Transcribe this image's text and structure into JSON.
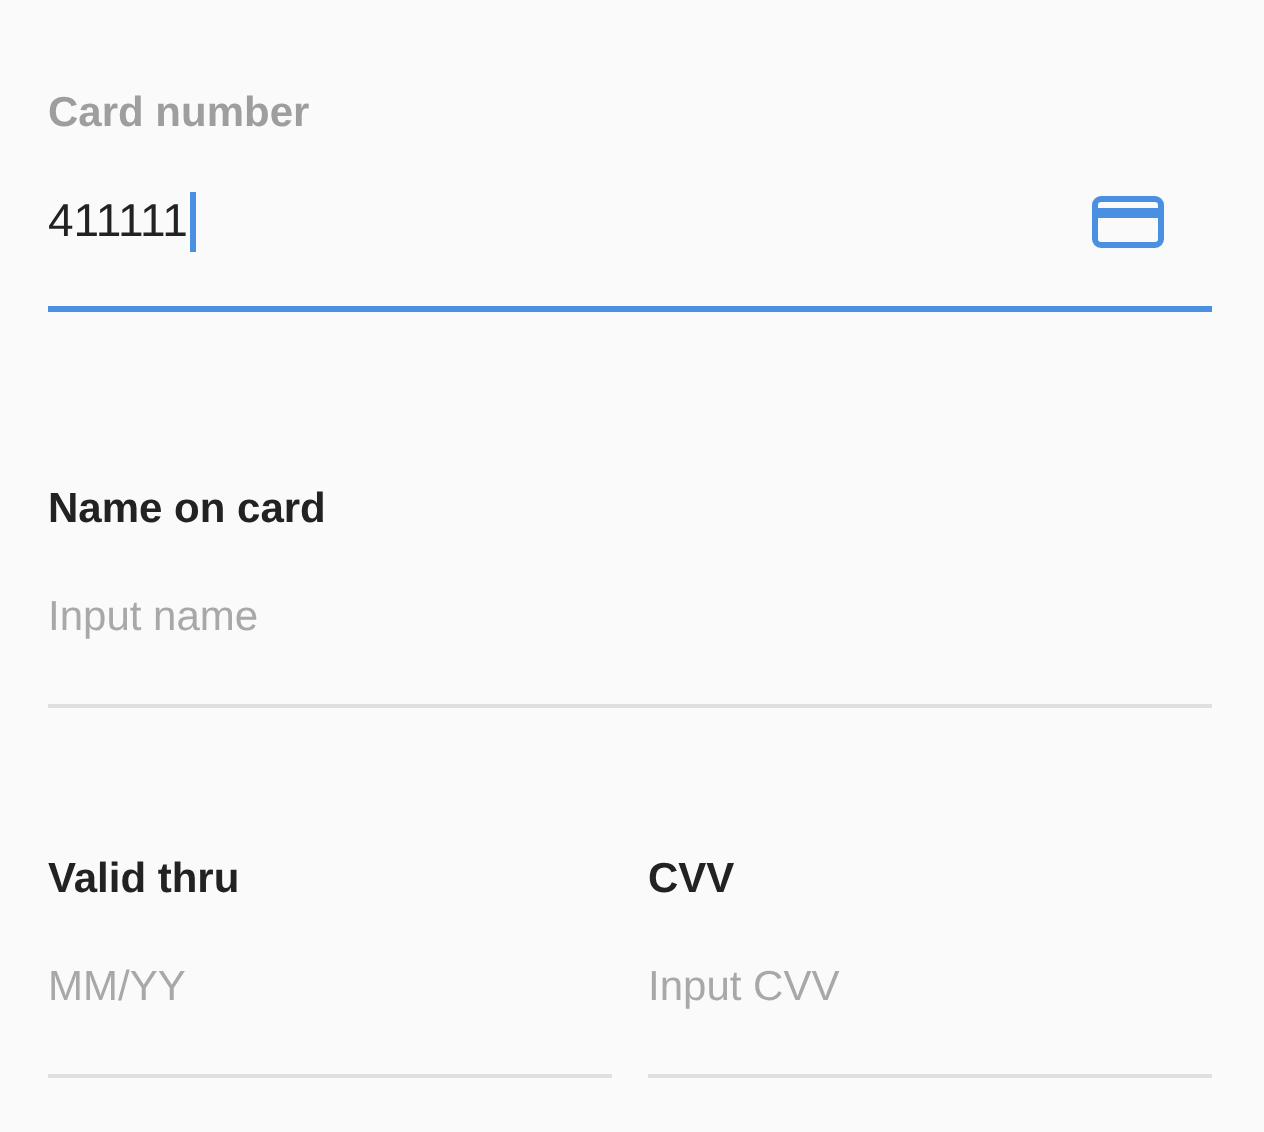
{
  "fields": [
    {
      "label": "Card number",
      "value": "411111",
      "focused": true
    },
    {
      "label": "Name on card",
      "placeholder": "Input name",
      "focused": false
    }
  ],
  "row": [
    {
      "label": "Valid thru",
      "placeholder": "MM/YY",
      "focused": false
    },
    {
      "label": "CVV",
      "placeholder": "Input CVV",
      "focused": false
    }
  ]
}
